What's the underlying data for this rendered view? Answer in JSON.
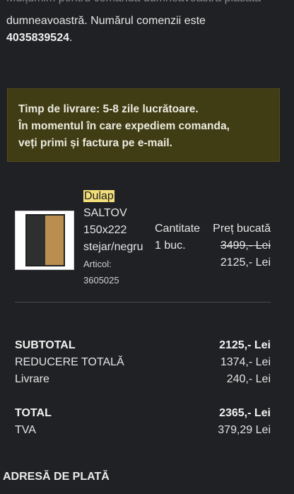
{
  "intro": {
    "cut_text": "Mulțumim pentru comanda dumneavoastră plasată",
    "line1": "dumneavoastră. Numărul comenzii este",
    "order_number": "4035839524",
    "order_suffix": "."
  },
  "notice": {
    "line1": "Timp de livrare: 5-8 zile lucrătoare.",
    "line2": "În momentul în care expediem comanda,",
    "line3": "veți primi și factura pe e-mail."
  },
  "product": {
    "name_highlight": "Dulap",
    "name_line2": "SALTOV",
    "name_line3": "150x222",
    "name_line4": "stejar/negru",
    "article_label": "Articol:",
    "article_number": "3605025",
    "quantity_label": "Cantitate",
    "quantity_value": "1 buc.",
    "unit_price_label": "Preț bucată",
    "old_price": "3499,- Lei",
    "new_price": "2125,- Lei"
  },
  "summary": {
    "subtotal_label": "SUBTOTAL",
    "subtotal_value": "2125,- Lei",
    "discount_label": "REDUCERE TOTALĂ",
    "discount_value": "1374,- Lei",
    "shipping_label": "Livrare",
    "shipping_value": "240,- Lei",
    "total_label": "TOTAL",
    "total_value": "2365,- Lei",
    "vat_label": "TVA",
    "vat_value": "379,29 Lei"
  },
  "billing": {
    "title": "ADRESĂ DE PLATĂ"
  }
}
